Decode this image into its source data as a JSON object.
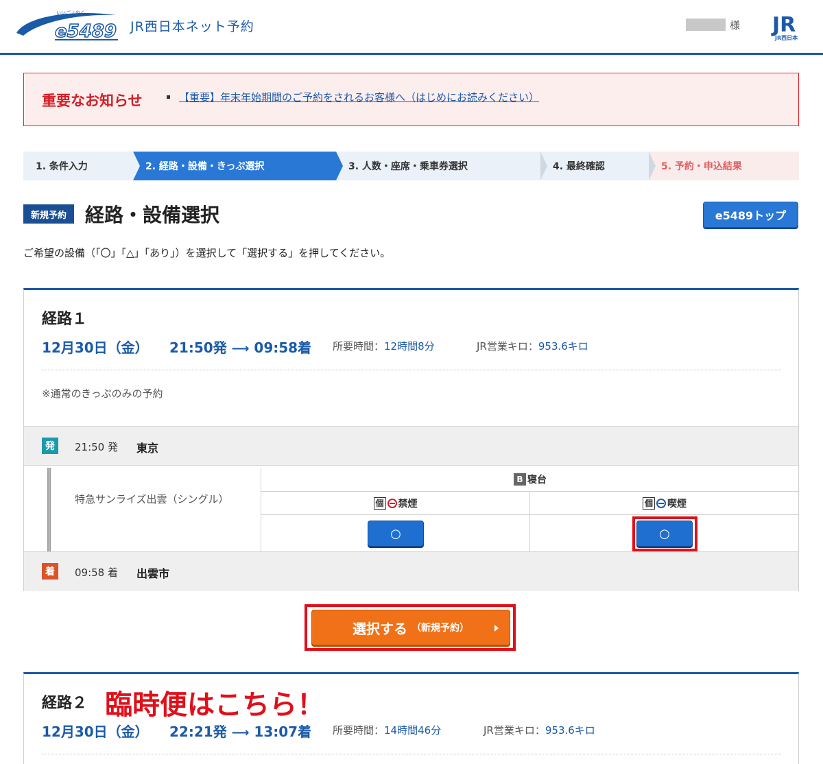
{
  "header": {
    "logo_text": "e5489",
    "logo_ruby": "いいごよやく",
    "title": "JR西日本ネット予約",
    "user_suffix": "様",
    "jr_logo_text": "JR",
    "jr_logo_sub": "JR西日本"
  },
  "notice": {
    "title": "重要なお知らせ",
    "link": "【重要】年末年始期間のご予約をされるお客様へ（はじめにお読みください）"
  },
  "steps": [
    {
      "label": "1. 条件入力",
      "state": "done",
      "color": "#333333",
      "bg": "#eaf1f9"
    },
    {
      "label": "2. 経路・設備・きっぷ選択",
      "state": "current",
      "color": "#ffffff",
      "bg": "#2a78d6"
    },
    {
      "label": "3. 人数・座席・乗車券選択",
      "state": "todo",
      "color": "#333333",
      "bg": "#eaf1f9"
    },
    {
      "label": "4. 最終確認",
      "state": "todo",
      "color": "#333333",
      "bg": "#eaf1f9"
    },
    {
      "label": "5. 予約・申込結果",
      "state": "todo",
      "color": "#e06060",
      "bg": "#fbecec"
    }
  ],
  "page": {
    "badge": "新規予約",
    "title": "経路・設備選択",
    "top_button": "e5489トップ",
    "instruction": "ご希望の設備（「〇」「△」「あり」）を選択して「選択する」を押してください。"
  },
  "route1": {
    "label": "経路１",
    "date": "12月30日（金）",
    "dep_time": "21:50発",
    "arr_time": "09:58着",
    "duration_label": "所要時間：",
    "duration": "12時間8分",
    "km_label": "JR営業キロ：",
    "km": "953.6キロ",
    "note": "※通常のきっぷのみの予約",
    "departure": {
      "icon": "発",
      "time": "21:50 発",
      "station": "東京"
    },
    "arrival": {
      "icon": "着",
      "time": "09:58 着",
      "station": "出雲市"
    },
    "train": "特急サンライズ出雲（シングル）",
    "seat_header_icon": "B",
    "seat_header": "寝台",
    "seat_types": [
      {
        "icon": "個",
        "label": "禁煙",
        "availability": "○"
      },
      {
        "icon": "個",
        "label": "喫煙",
        "availability": "○"
      }
    ]
  },
  "select_button": {
    "main": "選択する",
    "sub": "（新規予約）"
  },
  "route2": {
    "label": "経路２",
    "annotation": "臨時便はこちら！",
    "date": "12月30日（金）",
    "dep_time": "22:21発",
    "arr_time": "13:07着",
    "duration_label": "所要時間：",
    "duration": "14時間46分",
    "km_label": "JR営業キロ：",
    "km": "953.6キロ"
  },
  "colors": {
    "brand_blue": "#1a5aa8",
    "alert_red": "#e0101a",
    "orange": "#f07117",
    "dep_icon": "#1b9aaa",
    "arr_icon": "#d9542a"
  }
}
